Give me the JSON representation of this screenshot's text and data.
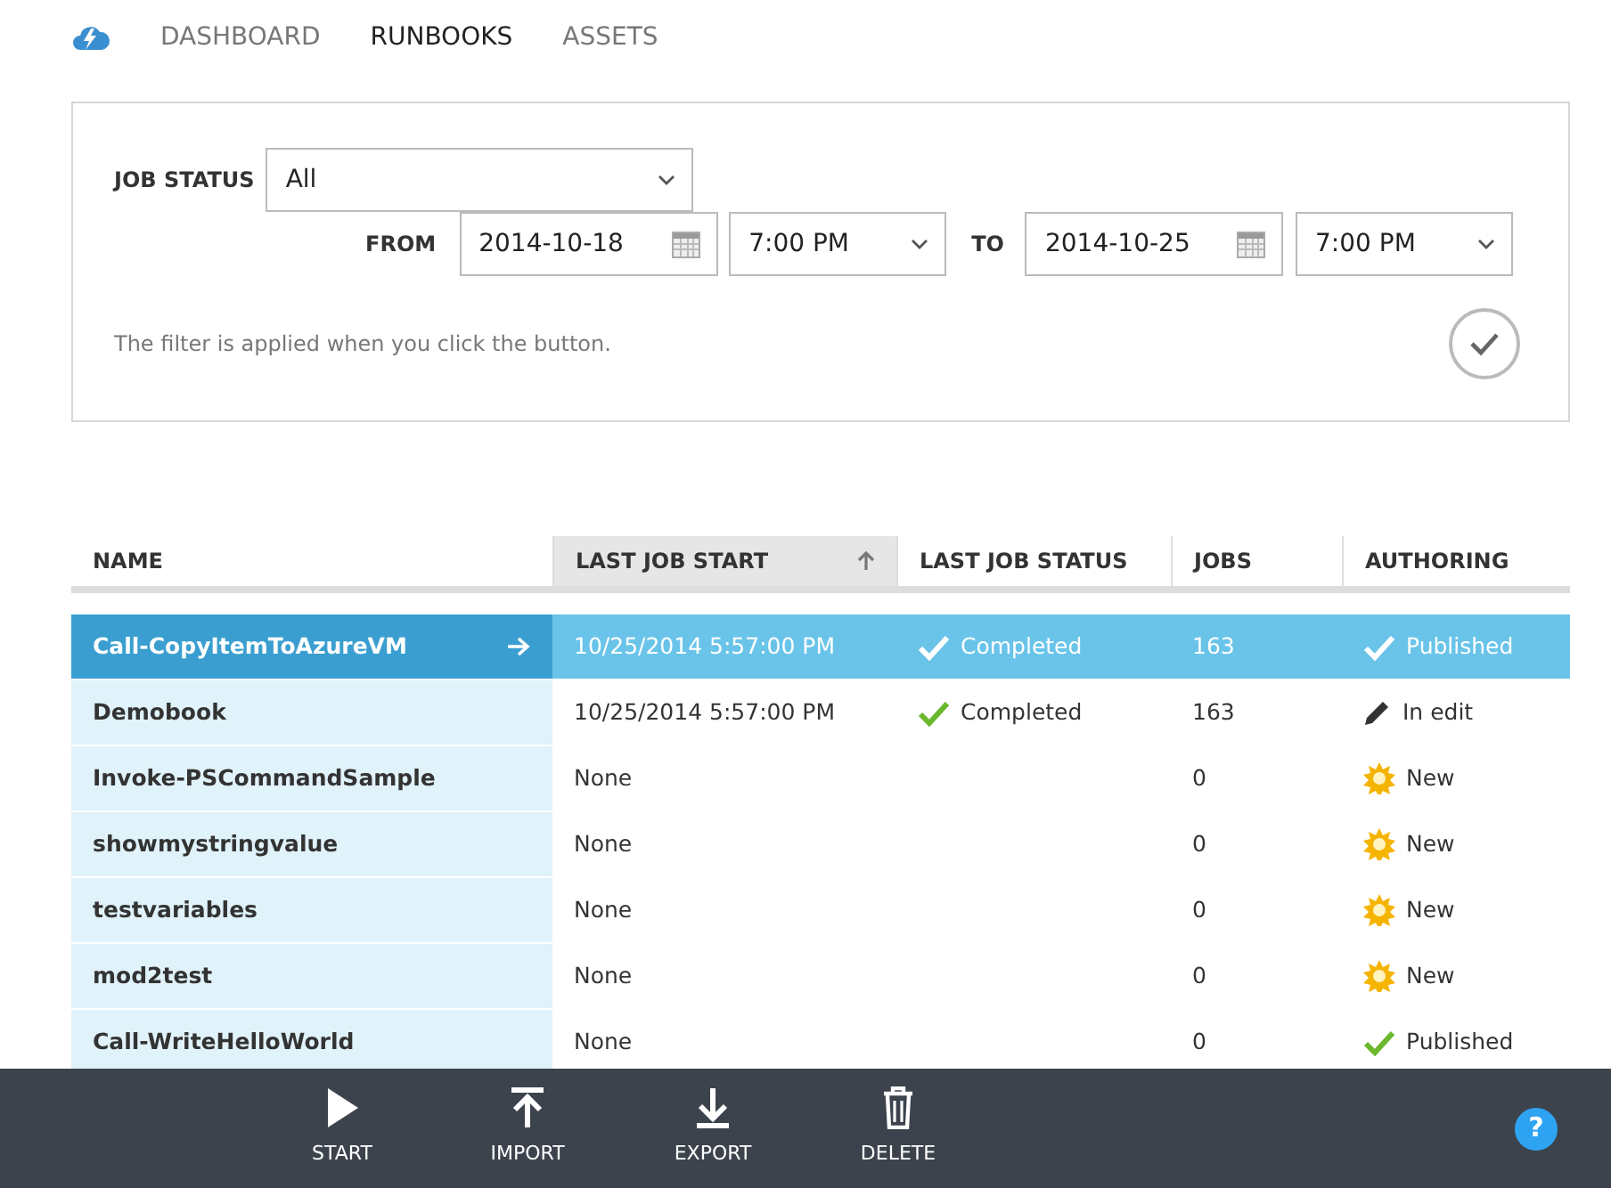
{
  "nav": [
    {
      "label": "DASHBOARD",
      "selected": false
    },
    {
      "label": "RUNBOOKS",
      "selected": true
    },
    {
      "label": "ASSETS",
      "selected": false
    }
  ],
  "filter": {
    "job_status": {
      "label": "JOB STATUS",
      "value": "All"
    },
    "from": {
      "label": "FROM",
      "date": "2014-10-18",
      "time": "7:00 PM"
    },
    "to": {
      "label": "TO",
      "date": "2014-10-25",
      "time": "7:00 PM"
    },
    "note": "The filter is applied when you click the button."
  },
  "table": {
    "columns": [
      {
        "label": "NAME",
        "sorted": false
      },
      {
        "label": "LAST JOB START",
        "sorted": true
      },
      {
        "label": "LAST JOB STATUS",
        "sorted": false
      },
      {
        "label": "JOBS",
        "sorted": false
      },
      {
        "label": "AUTHORING",
        "sorted": false
      }
    ],
    "rows": [
      {
        "name": "Call-CopyItemToAzureVM",
        "selected": true,
        "last_job_start": "10/25/2014 5:57:00 PM",
        "last_job_status": {
          "text": "Completed",
          "kind": "check"
        },
        "jobs": "163",
        "authoring": {
          "text": "Published",
          "kind": "check"
        }
      },
      {
        "name": "Demobook",
        "selected": false,
        "last_job_start": "10/25/2014 5:57:00 PM",
        "last_job_status": {
          "text": "Completed",
          "kind": "check"
        },
        "jobs": "163",
        "authoring": {
          "text": "In edit",
          "kind": "pencil"
        }
      },
      {
        "name": "Invoke-PSCommandSample",
        "selected": false,
        "last_job_start": "None",
        "jobs": "0",
        "authoring": {
          "text": "New",
          "kind": "sun"
        }
      },
      {
        "name": "showmystringvalue",
        "selected": false,
        "last_job_start": "None",
        "jobs": "0",
        "authoring": {
          "text": "New",
          "kind": "sun"
        }
      },
      {
        "name": "testvariables",
        "selected": false,
        "last_job_start": "None",
        "jobs": "0",
        "authoring": {
          "text": "New",
          "kind": "sun"
        }
      },
      {
        "name": "mod2test",
        "selected": false,
        "last_job_start": "None",
        "jobs": "0",
        "authoring": {
          "text": "New",
          "kind": "sun"
        }
      },
      {
        "name": "Call-WriteHelloWorld",
        "selected": false,
        "last_job_start": "None",
        "jobs": "0",
        "authoring": {
          "text": "Published",
          "kind": "check"
        }
      }
    ]
  },
  "command_bar": {
    "commands": [
      {
        "label": "START",
        "kind": "start"
      },
      {
        "label": "IMPORT",
        "kind": "import"
      },
      {
        "label": "EXPORT",
        "kind": "export"
      },
      {
        "label": "DELETE",
        "kind": "delete"
      }
    ],
    "help": "?"
  }
}
